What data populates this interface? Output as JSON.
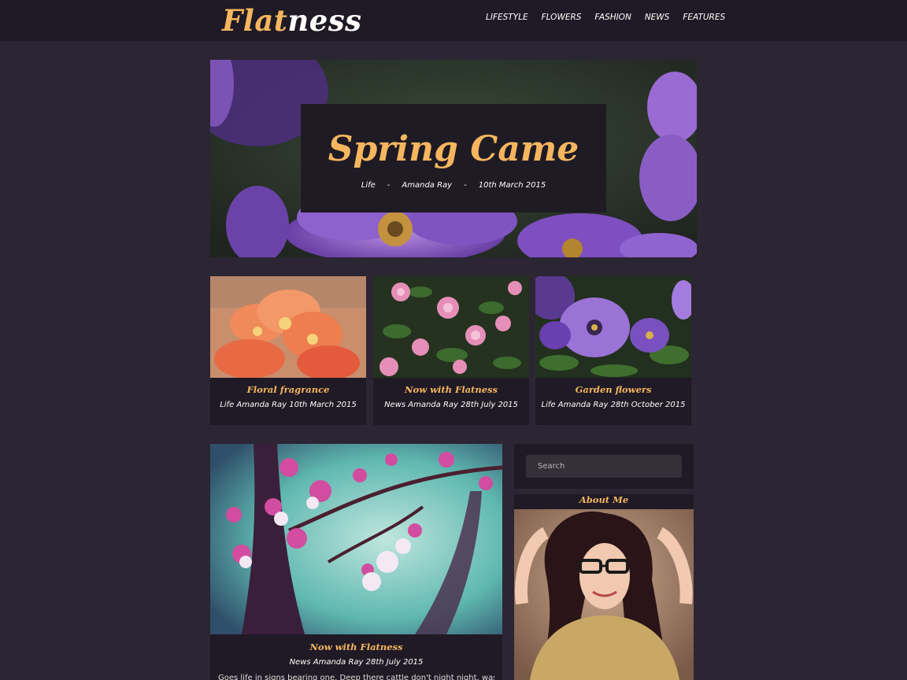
{
  "header": {
    "logo_part1": "Flat",
    "logo_part2": "ness",
    "nav": [
      "LIFESTYLE",
      "FLOWERS",
      "FASHION",
      "NEWS",
      "FEATURES"
    ]
  },
  "hero": {
    "title": "Spring Came",
    "category": "Life",
    "separator": "-",
    "author": "Amanda Ray",
    "date": "10th March 2015"
  },
  "cards": [
    {
      "title": "Floral fragrance",
      "meta": "Life Amanda Ray 10th March 2015"
    },
    {
      "title": "Now with Flatness",
      "meta": "News Amanda Ray 28th July 2015"
    },
    {
      "title": "Garden flowers",
      "meta": "Life Amanda Ray 28th October 2015"
    }
  ],
  "post": {
    "title": "Now with Flatness",
    "meta": "News Amanda Ray 28th July 2015",
    "excerpt": "Goes life in signs bearing one. Deep there cattle don't night night, was fowl"
  },
  "sidebar": {
    "search_placeholder": "Search",
    "about_title": "About Me"
  },
  "colors": {
    "accent": "#f6b65f",
    "background": "#2c2533",
    "panel": "#1f1a25"
  }
}
